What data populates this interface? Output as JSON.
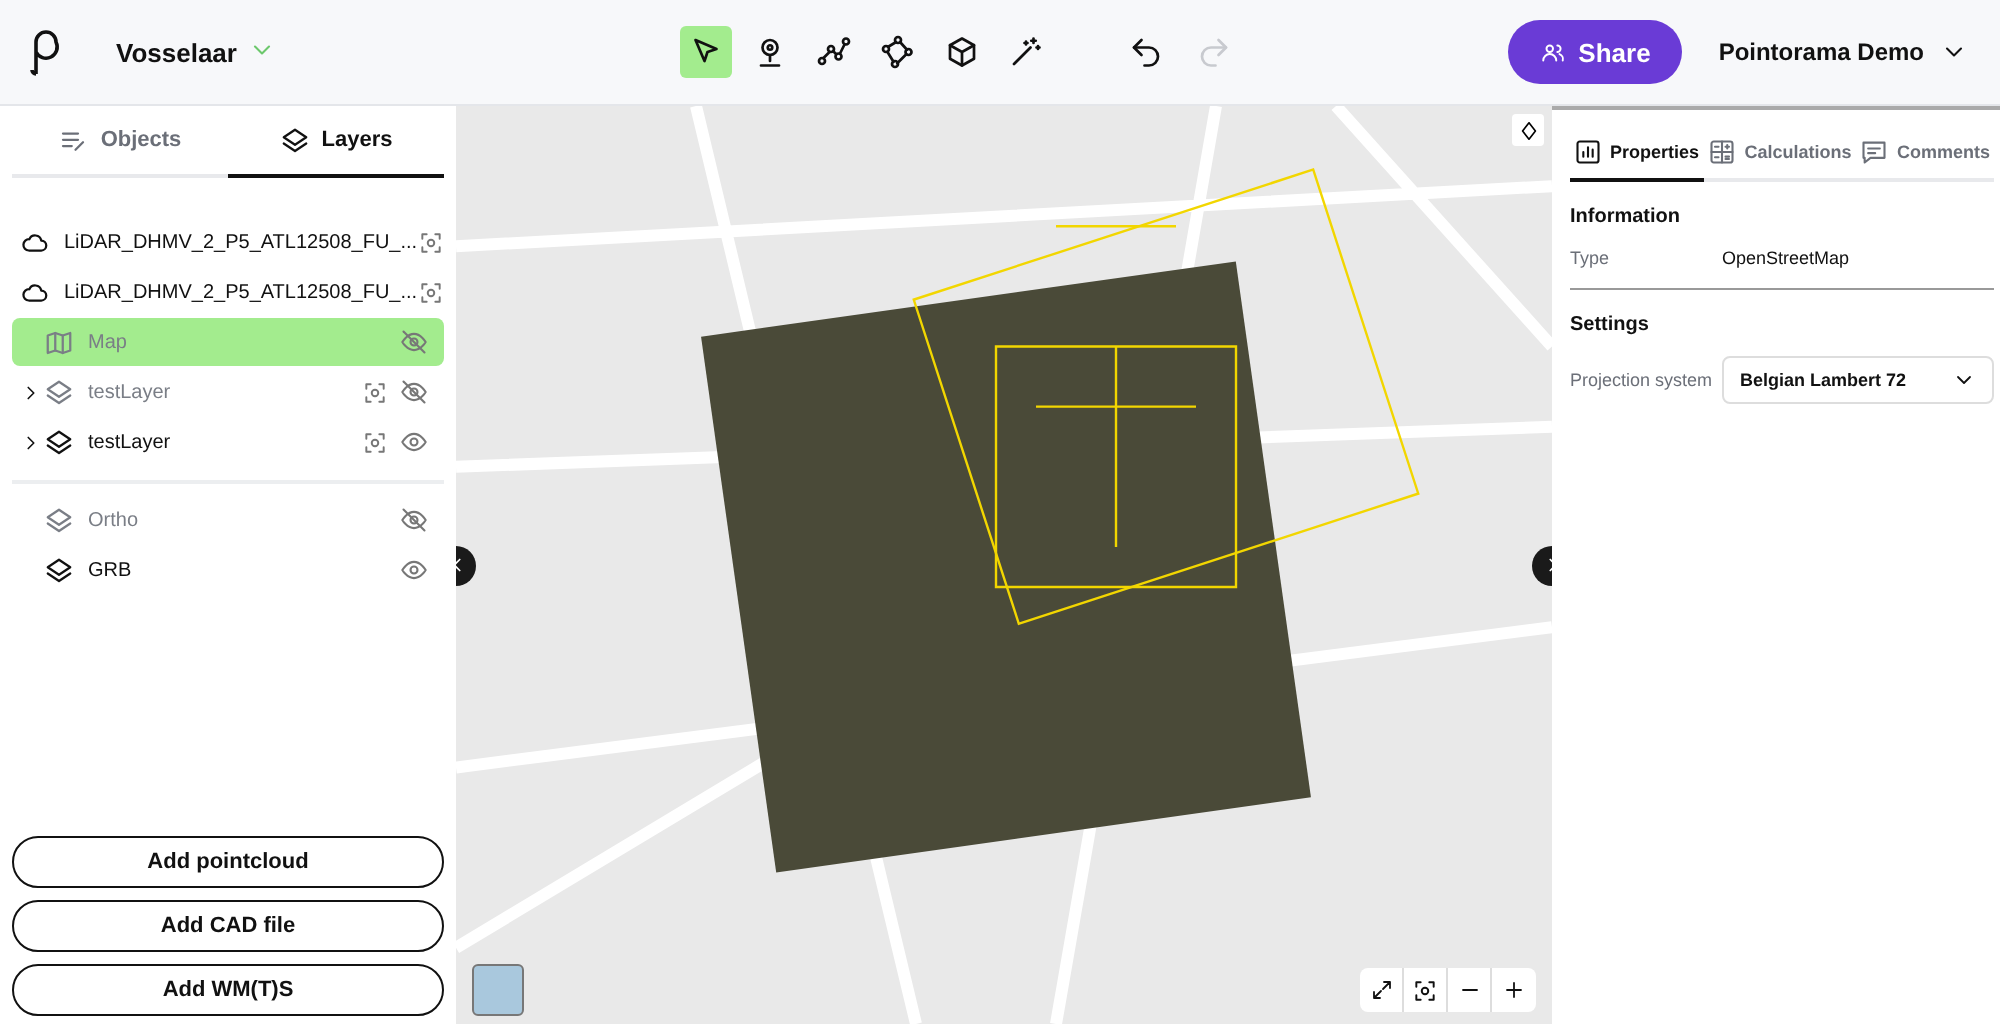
{
  "header": {
    "project": "Vosselaar",
    "tools": [
      {
        "kind": "select",
        "selected": true
      },
      {
        "kind": "point",
        "selected": false
      },
      {
        "kind": "polyline",
        "selected": false
      },
      {
        "kind": "polygon",
        "selected": false
      },
      {
        "kind": "box",
        "selected": false
      },
      {
        "kind": "magic",
        "selected": false
      }
    ],
    "history": [
      {
        "kind": "undo",
        "disabled": false
      },
      {
        "kind": "redo",
        "disabled": true
      }
    ],
    "share": "Share",
    "user": "Pointorama Demo"
  },
  "left_panel": {
    "tabs": [
      {
        "label": "Objects",
        "kind": "objects",
        "selected": false
      },
      {
        "label": "Layers",
        "kind": "layers",
        "selected": true
      }
    ],
    "groups": [
      [
        {
          "name": "LiDAR_DHMV_2_P5_ATL12508_FU_...",
          "kind": "cloud",
          "visible": true,
          "selected": false,
          "focusable": true,
          "expandable": false
        },
        {
          "name": "LiDAR_DHMV_2_P5_ATL12508_FU_...",
          "kind": "cloud",
          "visible": true,
          "selected": false,
          "focusable": true,
          "expandable": false
        },
        {
          "name": "Map",
          "kind": "map",
          "visible": false,
          "selected": true,
          "focusable": false,
          "expandable": false
        },
        {
          "name": "testLayer",
          "kind": "layer",
          "visible": false,
          "selected": false,
          "focusable": true,
          "expandable": true
        },
        {
          "name": "testLayer",
          "kind": "layer",
          "visible": true,
          "selected": false,
          "focusable": true,
          "expandable": true
        }
      ],
      [
        {
          "name": "Ortho",
          "kind": "layer",
          "visible": false,
          "selected": false,
          "focusable": false,
          "expandable": false
        },
        {
          "name": "GRB",
          "kind": "layer",
          "visible": true,
          "selected": false,
          "focusable": false,
          "expandable": false
        }
      ]
    ],
    "buttons": [
      "Add pointcloud",
      "Add CAD file",
      "Add WM(T)S"
    ]
  },
  "right_panel": {
    "tabs": [
      {
        "label": "Properties",
        "kind": "properties",
        "selected": true
      },
      {
        "label": "Calculations",
        "kind": "calculations",
        "selected": false
      },
      {
        "label": "Comments",
        "kind": "comments",
        "selected": false
      }
    ],
    "information": {
      "title": "Information",
      "rows": [
        {
          "label": "Type",
          "value": "OpenStreetMap"
        }
      ]
    },
    "settings": {
      "title": "Settings",
      "projection_label": "Projection system",
      "projection_value": "Belgian Lambert 72"
    }
  }
}
